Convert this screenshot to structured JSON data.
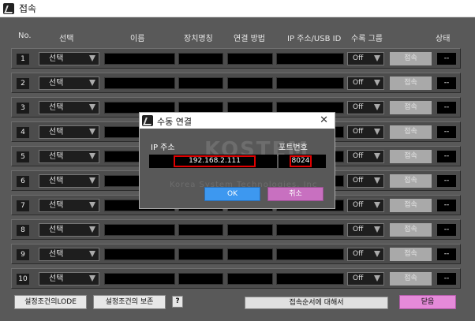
{
  "window": {
    "title": "접속"
  },
  "headers": {
    "no": "No.",
    "select": "선택",
    "name": "이름",
    "device": "장치명칭",
    "method": "연결 방법",
    "ip": "IP 주소/USB ID",
    "group": "수록 그룹",
    "status": "상태"
  },
  "rows": [
    {
      "no": "1",
      "select": "선택",
      "group": "Off",
      "connect": "접속",
      "status": "--"
    },
    {
      "no": "2",
      "select": "선택",
      "group": "Off",
      "connect": "접속",
      "status": "--"
    },
    {
      "no": "3",
      "select": "선택",
      "group": "Off",
      "connect": "접속",
      "status": "--"
    },
    {
      "no": "4",
      "select": "선택",
      "group": "Off",
      "connect": "접속",
      "status": "--"
    },
    {
      "no": "5",
      "select": "선택",
      "group": "Off",
      "connect": "접속",
      "status": "--"
    },
    {
      "no": "6",
      "select": "선택",
      "group": "Off",
      "connect": "접속",
      "status": "--"
    },
    {
      "no": "7",
      "select": "선택",
      "group": "Off",
      "connect": "접속",
      "status": "--"
    },
    {
      "no": "8",
      "select": "선택",
      "group": "Off",
      "connect": "접속",
      "status": "--"
    },
    {
      "no": "9",
      "select": "선택",
      "group": "Off",
      "connect": "접속",
      "status": "--"
    },
    {
      "no": "10",
      "select": "선택",
      "group": "Off",
      "connect": "접속",
      "status": "--"
    }
  ],
  "bottom": {
    "load": "설정조건의LODE",
    "save": "설정조건의 보존",
    "help": "?",
    "order": "접속순서에 대해서",
    "close": "닫음"
  },
  "dialog": {
    "title": "수동 연결",
    "ip_label": "IP 주소",
    "port_label": "포트번호",
    "ip_value": "192.168.2.111",
    "port_value": "8024",
    "ok": "OK",
    "cancel": "취소",
    "watermark": "Korea System Technologies, Inc"
  }
}
